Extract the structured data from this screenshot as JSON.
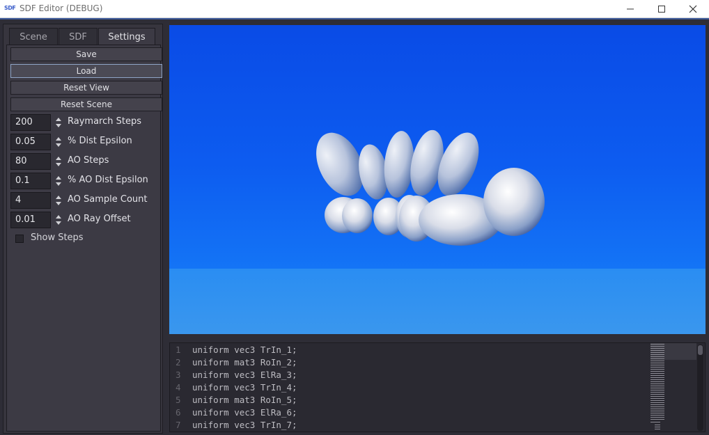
{
  "window": {
    "app_icon_text": "SDF",
    "title": "SDF Editor (DEBUG)"
  },
  "tabs": [
    {
      "label": "Scene",
      "active": false
    },
    {
      "label": "SDF",
      "active": false
    },
    {
      "label": "Settings",
      "active": true
    }
  ],
  "settings": {
    "buttons": {
      "save": "Save",
      "load": "Load",
      "reset_view": "Reset View",
      "reset_scene": "Reset Scene"
    },
    "fields": [
      {
        "value": "200",
        "label": "Raymarch Steps"
      },
      {
        "value": "0.05",
        "label": "% Dist Epsilon"
      },
      {
        "value": "80",
        "label": "AO Steps"
      },
      {
        "value": "0.1",
        "label": "% AO Dist Epsilon"
      },
      {
        "value": "4",
        "label": "AO Sample Count"
      },
      {
        "value": "0.01",
        "label": "AO Ray Offset"
      }
    ],
    "show_steps": {
      "label": "Show Steps",
      "checked": false
    }
  },
  "editor": {
    "lines": [
      {
        "n": "1",
        "code": "uniform vec3 TrIn_1;"
      },
      {
        "n": "2",
        "code": "uniform mat3 RoIn_2;"
      },
      {
        "n": "3",
        "code": "uniform vec3 ElRa_3;"
      },
      {
        "n": "4",
        "code": "uniform vec3 TrIn_4;"
      },
      {
        "n": "5",
        "code": "uniform mat3 RoIn_5;"
      },
      {
        "n": "6",
        "code": "uniform vec3 ElRa_6;"
      },
      {
        "n": "7",
        "code": "uniform vec3 TrIn_7;"
      }
    ]
  },
  "colors": {
    "accent": "#3d5a9a",
    "sky_top": "#0a4be6",
    "sky_bottom": "#1a86f4",
    "panel_bg": "#3c3a44"
  },
  "icons": [
    "app-icon",
    "minimize-icon",
    "maximize-icon",
    "close-icon",
    "spin-arrows-icon"
  ]
}
